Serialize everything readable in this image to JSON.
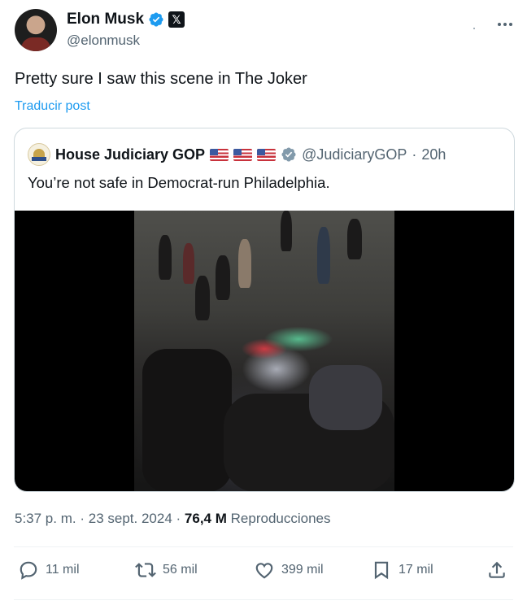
{
  "author": {
    "name": "Elon Musk",
    "handle": "@elonmusk",
    "badge_letter": "𝕏"
  },
  "tweet": {
    "text": "Pretty sure I saw this scene in The Joker",
    "translate_label": "Traducir post"
  },
  "quote": {
    "name": "House Judiciary GOP",
    "handle": "@JudiciaryGOP",
    "separator": "·",
    "time": "20h",
    "text": "You’re not safe in Democrat-run Philadelphia."
  },
  "meta": {
    "time": "5:37 p. m.",
    "separator": "·",
    "date": "23 sept. 2024",
    "separator2": "·",
    "views_count": "76,4 M",
    "views_label": "Reproducciones"
  },
  "actions": {
    "replies": "11 mil",
    "reposts": "56 mil",
    "likes": "399 mil",
    "bookmarks": "17 mil"
  },
  "colors": {
    "accent": "#1d9bf0",
    "text": "#0f1419",
    "secondary": "#536471",
    "border": "#cfd9de"
  }
}
